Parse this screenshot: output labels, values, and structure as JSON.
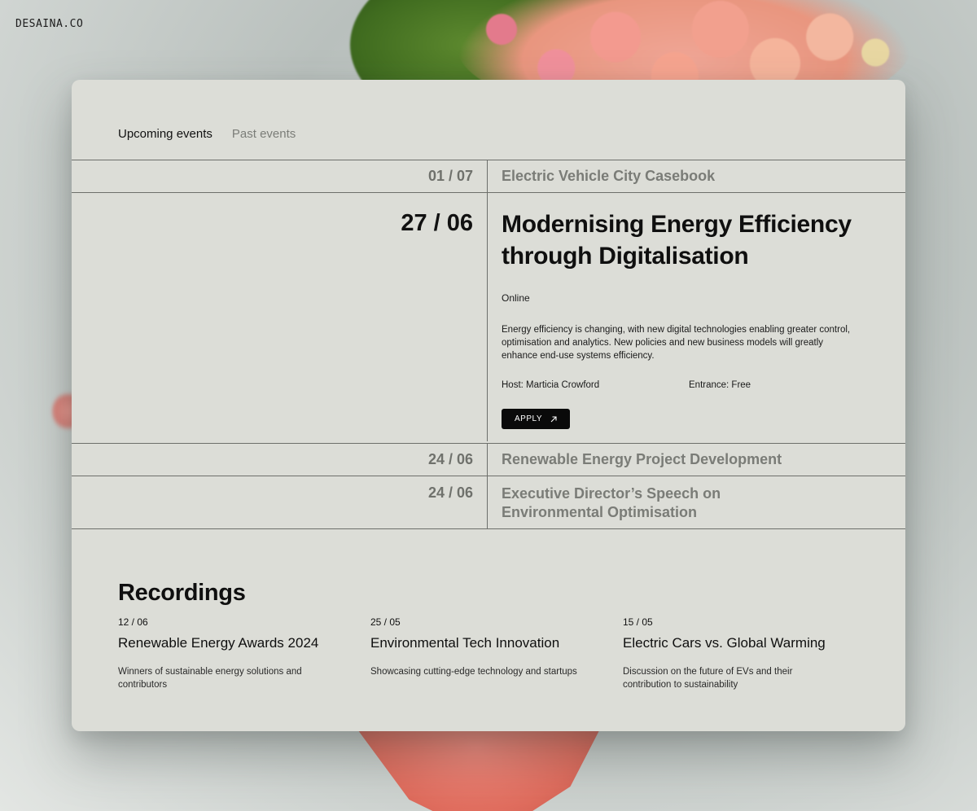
{
  "brand": "DESAINA.CO",
  "tabs": [
    {
      "label": "Upcoming events",
      "active": true
    },
    {
      "label": "Past events",
      "active": false
    }
  ],
  "events": [
    {
      "date": "01 / 07",
      "title": "Electric Vehicle City Casebook"
    },
    {
      "date": "27 / 06",
      "title": "Modernising Energy Efficiency through Digitalisation",
      "location": "Online",
      "description": "Energy efficiency is changing, with new digital technologies enabling greater control, optimisation and analytics. New policies and new business models will greatly enhance end-use systems efficiency.",
      "host": "Host: Marticia Crowford",
      "entrance": "Entrance: Free",
      "apply_label": "APPLY",
      "apply_icon": "arrow-up-right-icon"
    },
    {
      "date": "24 / 06",
      "title": "Renewable Energy Project Development"
    },
    {
      "date": "24 / 06",
      "title": "Executive Director’s Speech on Environmental Optimisation"
    }
  ],
  "recordings": {
    "title": "Recordings",
    "items": [
      {
        "date": "12 / 06",
        "title": "Renewable Energy Awards 2024",
        "description": "Winners of sustainable energy solutions and contributors"
      },
      {
        "date": "25 / 05",
        "title": "Environmental Tech Innovation",
        "description": "Showcasing cutting-edge technology and startups"
      },
      {
        "date": "15 / 05",
        "title": "Electric Cars vs. Global Warming",
        "description": "Discussion on the future of EVs and their contribution to sustainability"
      }
    ]
  },
  "colors": {
    "card": "#dcddd7",
    "apply_button": "#0a0a0a",
    "muted_text": "#7a7c77"
  }
}
